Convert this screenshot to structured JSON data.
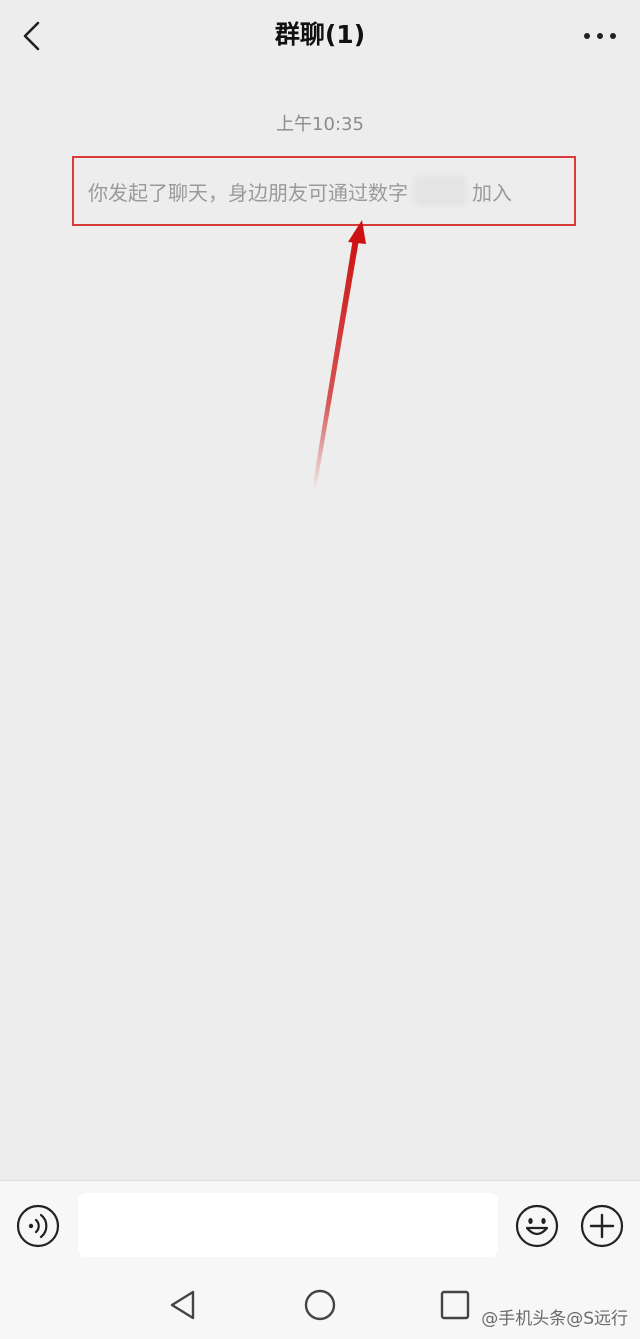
{
  "header": {
    "back_icon": "chevron-left-icon",
    "title": "群聊(1)",
    "more_icon": "more-dots-icon"
  },
  "chat": {
    "timestamp": "上午10:35",
    "system_message": {
      "prefix": "你发起了聊天，身边朋友可通过数字",
      "suffix": "加入",
      "highlight_color": "#d93a3a"
    },
    "annotation_arrow_color": "#cc1111"
  },
  "input_bar": {
    "voice_icon": "voice-icon",
    "input_value": "",
    "emoji_icon": "emoji-icon",
    "plus_icon": "plus-circle-icon"
  },
  "nav_bar": {
    "back_icon": "triangle-back-icon",
    "home_icon": "circle-home-icon",
    "recent_icon": "square-recent-icon"
  },
  "watermark": "@手机头条@S远行"
}
